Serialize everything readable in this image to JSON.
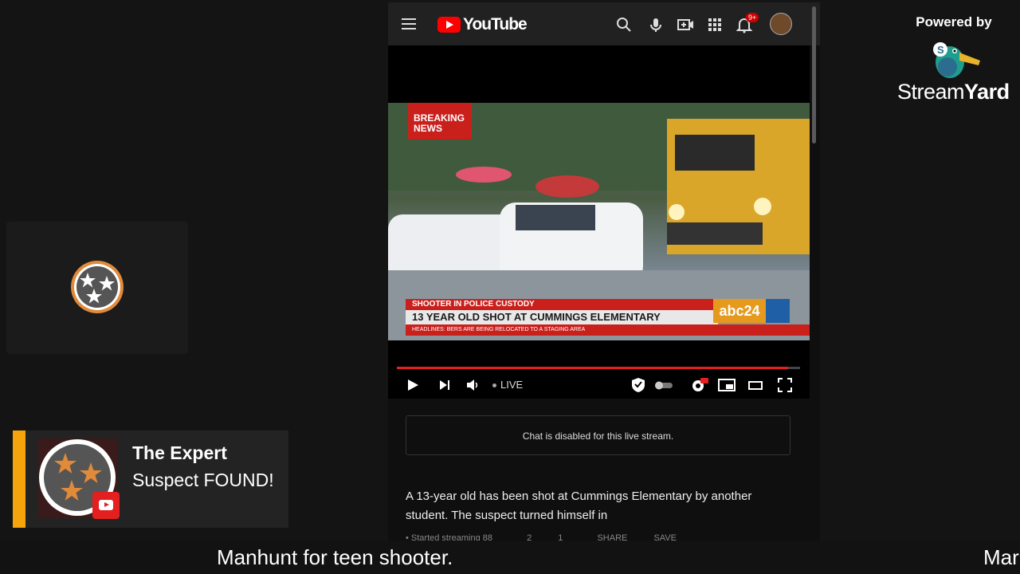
{
  "branding": {
    "powered_by": "Powered by",
    "name_a": "Stream",
    "name_b": "Yard"
  },
  "youtube": {
    "logo_text": "YouTube",
    "notification_count": "9+",
    "icons": [
      "menu-icon",
      "search-icon",
      "mic-icon",
      "create-icon",
      "apps-icon",
      "bell-icon"
    ]
  },
  "video": {
    "breaking_line1": "BREAKING",
    "breaking_line2": "NEWS",
    "lower_red": "SHOOTER IN POLICE CUSTODY",
    "lower_main": "13 YEAR OLD SHOT AT CUMMINGS ELEMENTARY",
    "headline": "HEADLINES: BERS ARE BEING RELOCATED TO A STAGING AREA",
    "station": "abc24",
    "progress": 0.97,
    "live_label": "LIVE"
  },
  "chat": {
    "disabled_text": "Chat is disabled for this live stream."
  },
  "description": {
    "text": "A 13-year old has been shot at Cummings Elementary by another student. The suspect turned himself in",
    "meta_started": "• Started streaming 88",
    "meta_likes": "2",
    "meta_comments": "1",
    "meta_share": "SHARE",
    "meta_save": "SAVE"
  },
  "card": {
    "name": "The Expert",
    "message": "Suspect FOUND!"
  },
  "ticker": {
    "text": "Manhunt for teen shooter.",
    "text_repeat": "Mar"
  },
  "colors": {
    "accent_orange": "#f5a40c",
    "youtube_red": "#ff0000",
    "background": "#141414"
  }
}
